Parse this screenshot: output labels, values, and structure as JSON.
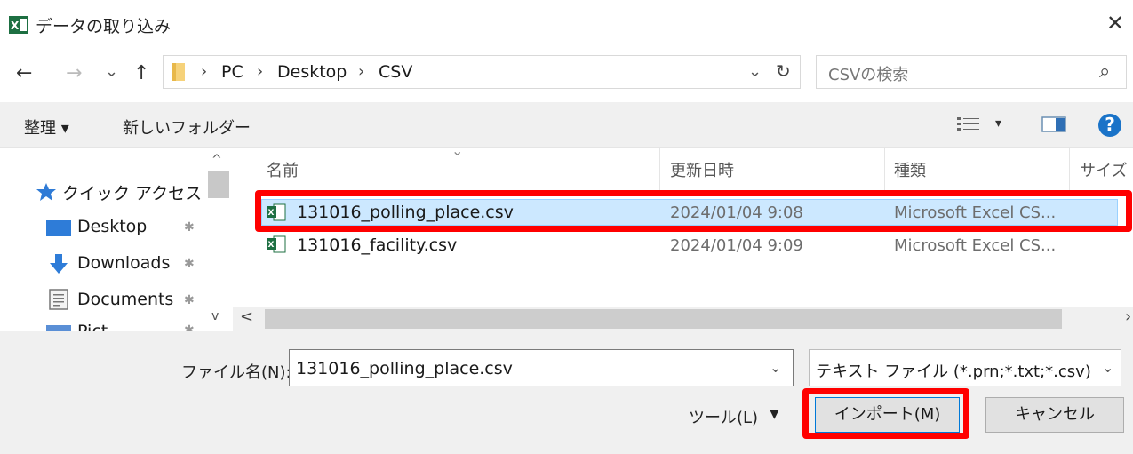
{
  "window": {
    "title": "データの取り込み",
    "close_glyph": "✕",
    "app_icon": "excel-icon"
  },
  "nav": {
    "back_glyph": "←",
    "forward_glyph": "→",
    "recent_glyph": "⌄",
    "up_glyph": "↑",
    "breadcrumb": [
      "PC",
      "Desktop",
      "CSV"
    ],
    "sep_glyph": "›",
    "dropdown_glyph": "⌄",
    "refresh_glyph": "↻",
    "search_placeholder": "CSVの検索",
    "search_glyph": "⌕"
  },
  "toolbar": {
    "organize_label": "整理 ▾",
    "new_folder_label": "新しいフォルダー",
    "view_caret": "▾",
    "help_glyph": "?"
  },
  "sidebar": {
    "items": [
      {
        "label": "クイック アクセス",
        "icon": "star-icon"
      },
      {
        "label": "Desktop",
        "icon": "desktop-icon",
        "pinned": true
      },
      {
        "label": "Downloads",
        "icon": "download-icon",
        "pinned": true
      },
      {
        "label": "Documents",
        "icon": "documents-icon",
        "pinned": true
      },
      {
        "label": "Pict",
        "icon": "pictures-icon",
        "pinned": true
      }
    ],
    "pin_glyph": "✱",
    "scroll_up": "^",
    "scroll_down": "v"
  },
  "filelist": {
    "sort_glyph": "⌄",
    "columns": [
      "名前",
      "更新日時",
      "種類",
      "サイズ"
    ],
    "rows": [
      {
        "name": "131016_polling_place.csv",
        "modified": "2024/01/04 9:08",
        "type": "Microsoft Excel CS...",
        "selected": true
      },
      {
        "name": "131016_facility.csv",
        "modified": "2024/01/04 9:09",
        "type": "Microsoft Excel CS...",
        "selected": false
      }
    ],
    "hscroll_left": "<",
    "hscroll_right": "›"
  },
  "footer": {
    "filename_label": "ファイル名(N):",
    "filename_value": "131016_polling_place.csv",
    "filetype_value": "テキスト ファイル (*.prn;*.txt;*.csv)",
    "caret_glyph": "⌄",
    "tools_label": "ツール(L)",
    "tools_caret": "▼",
    "import_label": "インポート(M)",
    "cancel_label": "キャンセル"
  },
  "colors": {
    "highlight": "#ff0000",
    "selection": "#cce8ff",
    "excel_green": "#1d6f42",
    "help_blue": "#1a73c8"
  }
}
